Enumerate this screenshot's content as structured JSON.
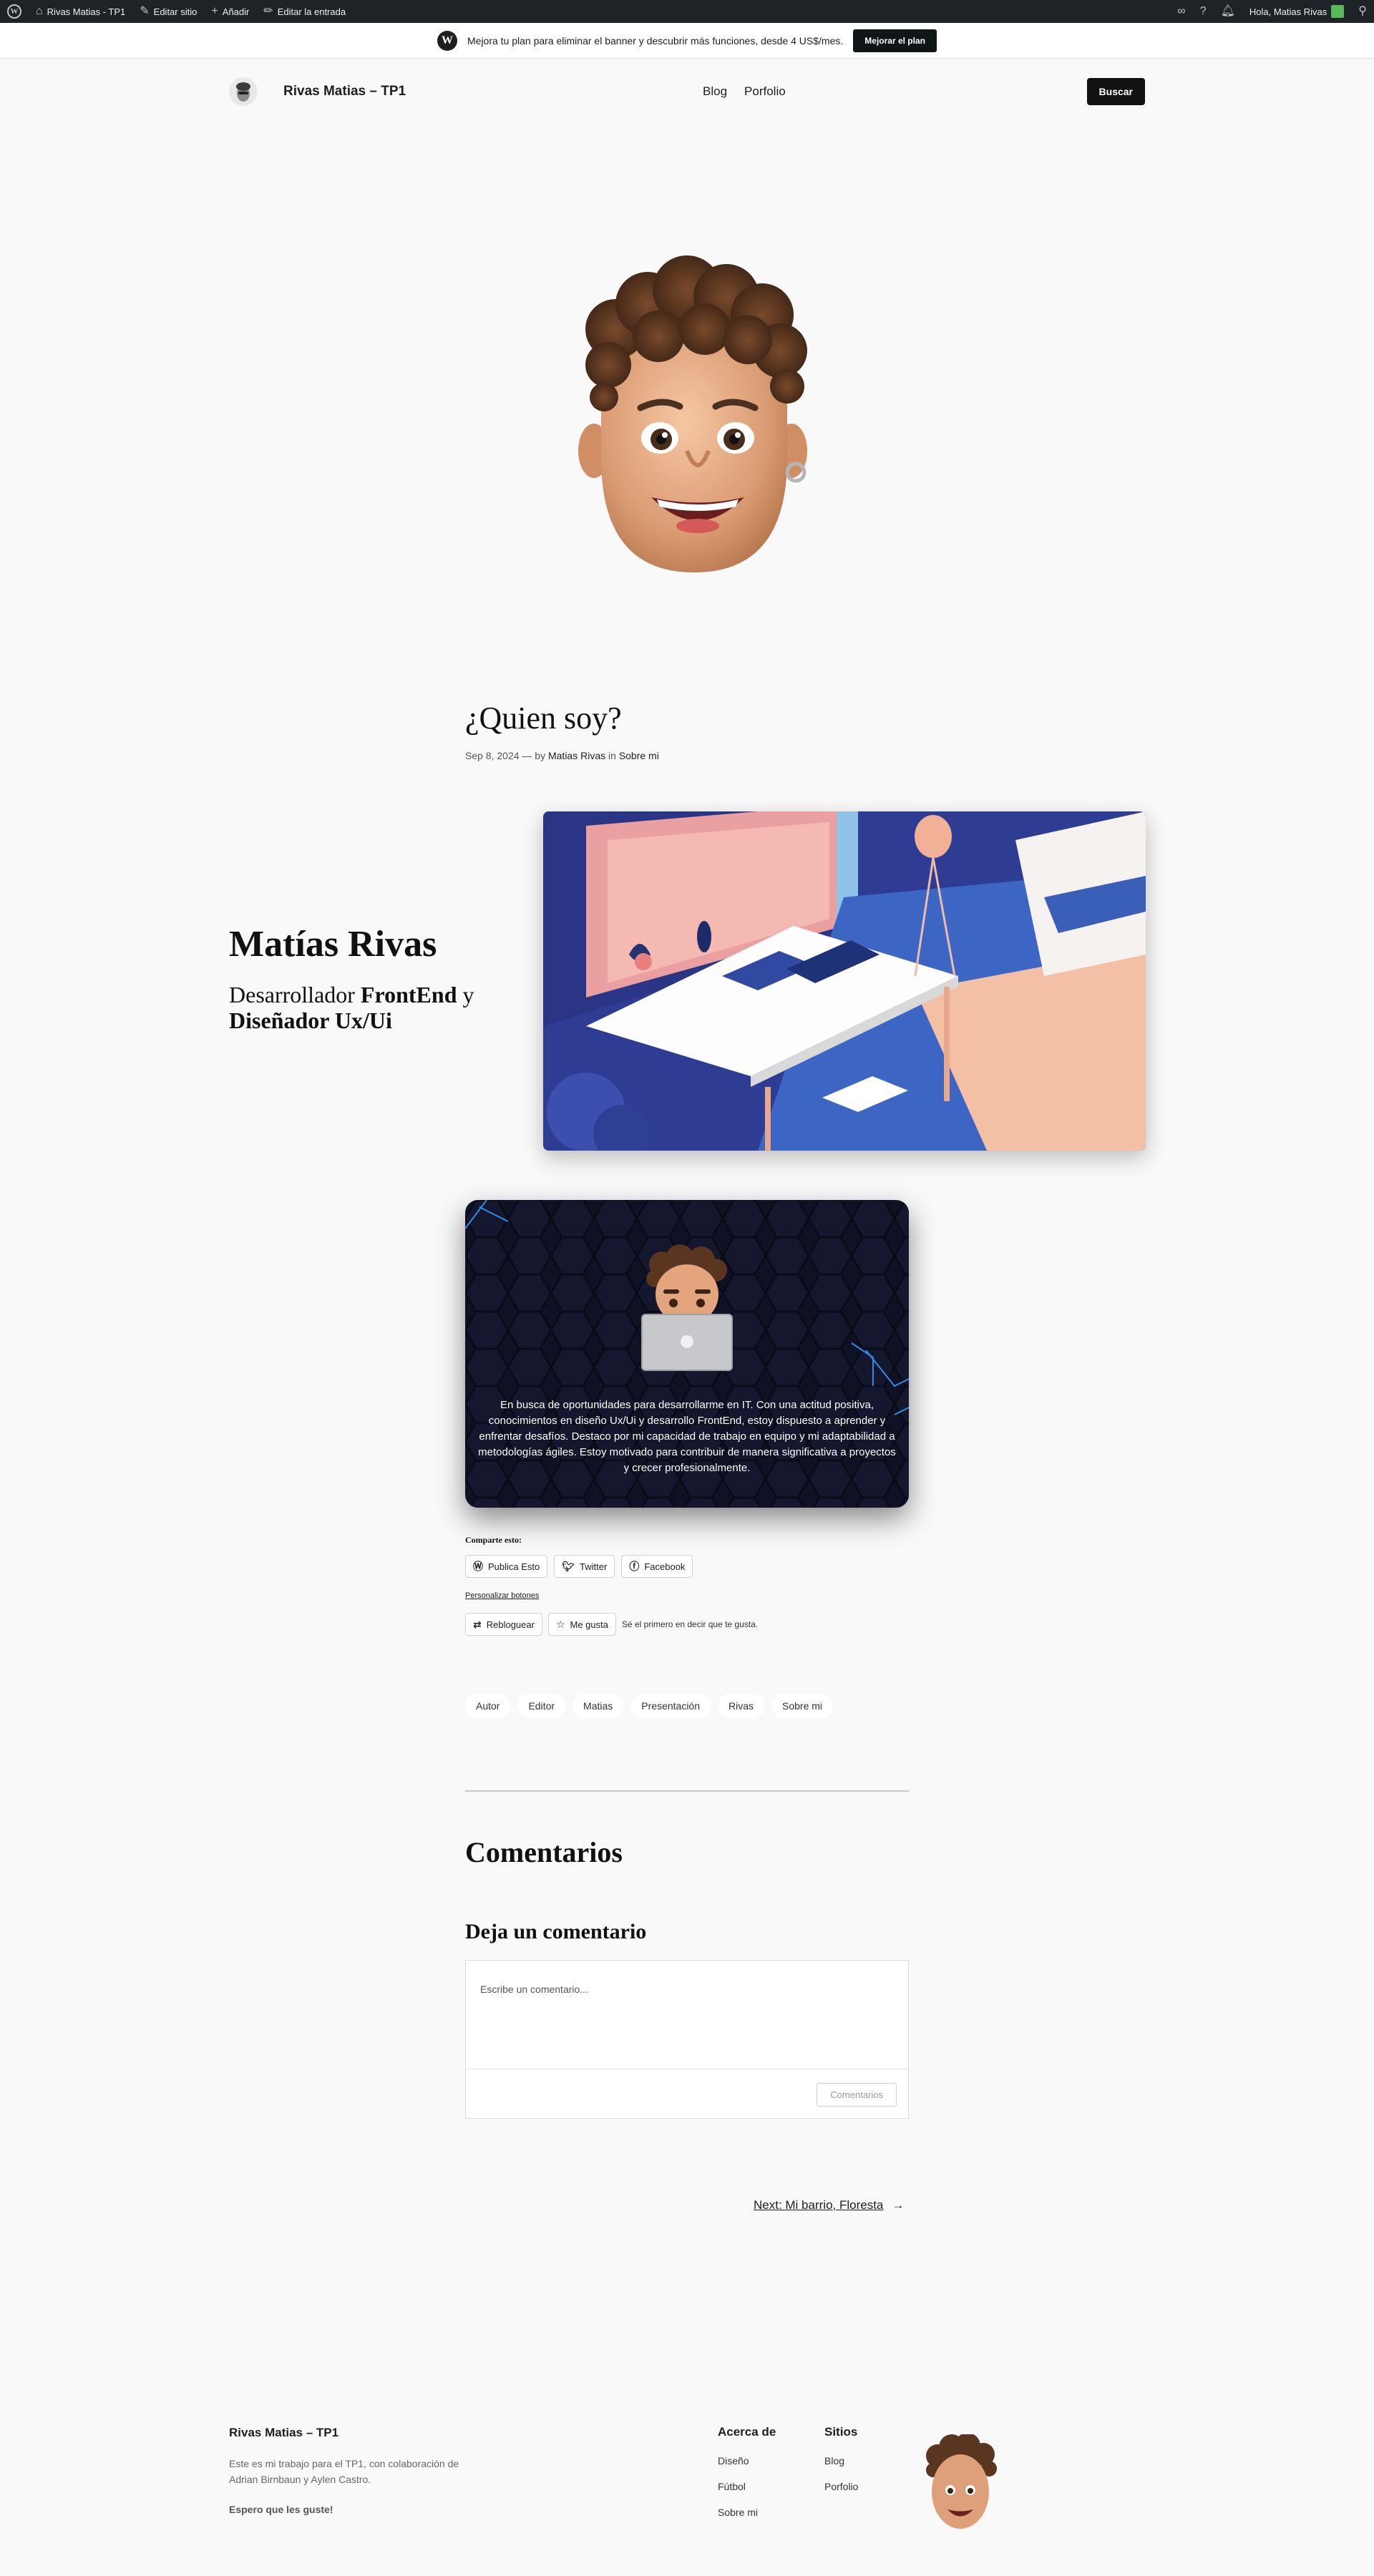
{
  "adminbar": {
    "site": "Rivas Matias - TP1",
    "edit_site": "Editar sitio",
    "add": "Añadir",
    "edit_post": "Editar la entrada",
    "greeting": "Hola, Matias Rivas"
  },
  "banner": {
    "text": "Mejora tu plan para eliminar el banner y descubrir más funciones, desde 4 US$/mes.",
    "button": "Mejorar el plan"
  },
  "header": {
    "site_title": "Rivas Matias – TP1",
    "nav": [
      "Blog",
      "Porfolio"
    ],
    "search": "Buscar"
  },
  "post": {
    "title": "¿Quien soy?",
    "date": "Sep 8, 2024",
    "by": "— by",
    "author": "Matias Rivas",
    "in": "in",
    "category": "Sobre mi"
  },
  "intro": {
    "name": "Matías Rivas",
    "role_1": "Desarrollador ",
    "role_2": "FrontEnd",
    "role_3": " y ",
    "role_4": "Diseñador Ux/Ui"
  },
  "card": {
    "text": "En busca de oportunidades para desarrollarme en IT. Con una actitud positiva, conocimientos en diseño Ux/Ui y desarrollo FrontEnd, estoy dispuesto a aprender y enfrentar desafíos. Destaco por mi capacidad de trabajo en equipo y mi adaptabilidad a metodologías ágiles. Estoy motivado para contribuir de manera significativa a proyectos y crecer profesionalmente."
  },
  "share": {
    "title": "Comparte esto:",
    "buttons": [
      "Publica Esto",
      "Twitter",
      "Facebook"
    ],
    "customize": "Personalizar botones",
    "reblog": "Rebloguear",
    "like": "Me gusta",
    "like_note": "Sé el primero en decir que te gusta."
  },
  "tags": [
    "Autor",
    "Editor",
    "Matias",
    "Presentación",
    "Rivas",
    "Sobre mi"
  ],
  "comments": {
    "title": "Comentarios",
    "leave": "Deja un comentario",
    "placeholder": "Escribe un comentario...",
    "submit": "Comentarios"
  },
  "next": {
    "label": "Next: Mi barrio, Floresta",
    "arrow": "→"
  },
  "footer": {
    "title": "Rivas Matias – TP1",
    "desc": "Este es mi trabajo para el TP1, con colaboración de Adrian Birnbaun y Aylen Castro.",
    "hope": "Espero que les guste!",
    "col1_title": "Acerca de",
    "col1": [
      "Diseño",
      "Fútbol",
      "Sobre mi"
    ],
    "col2_title": "Sitios",
    "col2": [
      "Blog",
      "Porfolio"
    ]
  },
  "colors": {
    "adminbar": "#1d2327",
    "page_bg": "#f9f9f9",
    "card_bg": "#0f1124",
    "accent_dark": "#111111"
  }
}
